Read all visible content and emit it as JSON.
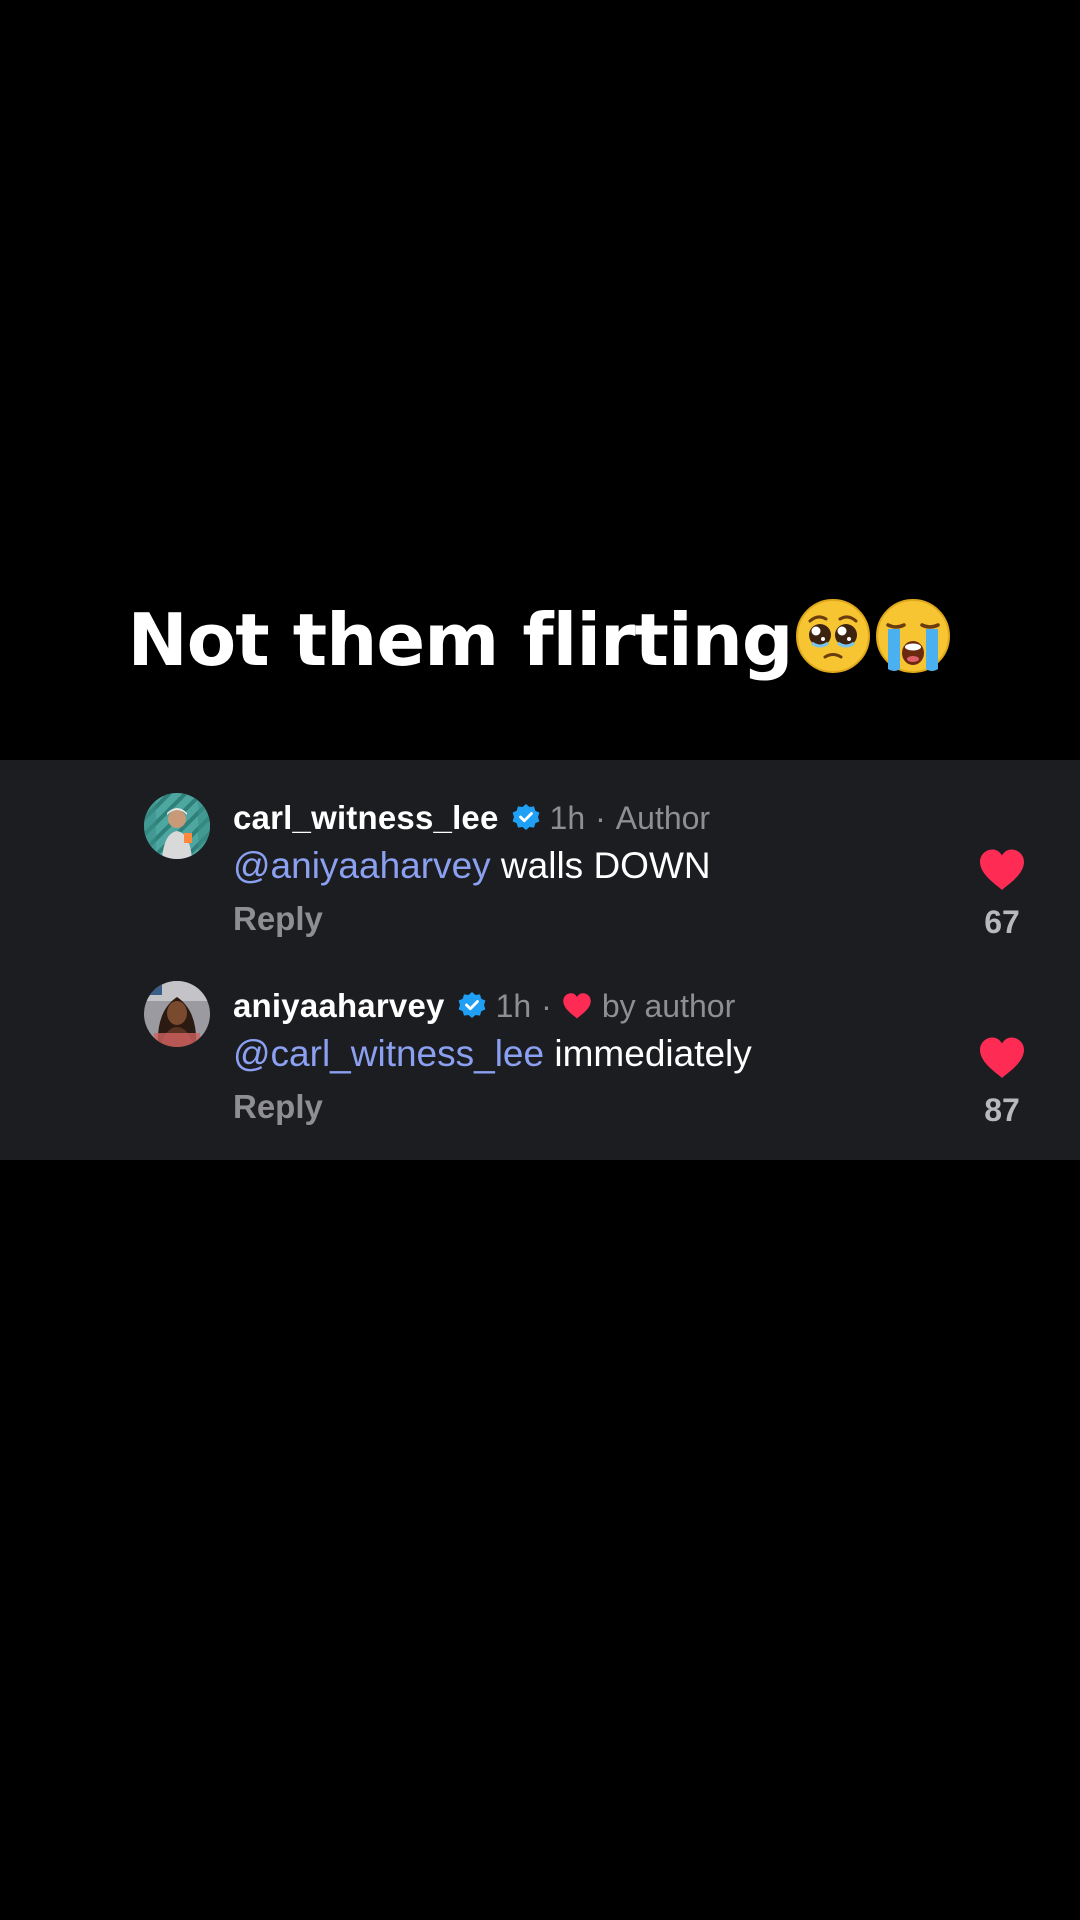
{
  "caption": {
    "text": "Not them flirting",
    "emojis": [
      "pleading-face-icon",
      "loudly-crying-face-icon"
    ]
  },
  "comments": [
    {
      "username": "carl_witness_lee",
      "verified": true,
      "time": "1h",
      "separator": "·",
      "tag": "Author",
      "mention": "@aniyaaharvey",
      "text": " walls DOWN",
      "reply_label": "Reply",
      "likes": "67",
      "liked": true
    },
    {
      "username": "aniyaaharvey",
      "verified": true,
      "time": "1h",
      "separator": "·",
      "tag": "by author",
      "tag_icon": "heart-icon",
      "mention": "@carl_witness_lee",
      "text": " immediately",
      "reply_label": "Reply",
      "likes": "87",
      "liked": true
    }
  ],
  "colors": {
    "background": "#000000",
    "panel": "#1b1d21",
    "mention": "#8ba0f0",
    "secondary_text": "#8e8e93",
    "like_heart": "#fe2c55",
    "verified_badge": "#20a0f5"
  }
}
